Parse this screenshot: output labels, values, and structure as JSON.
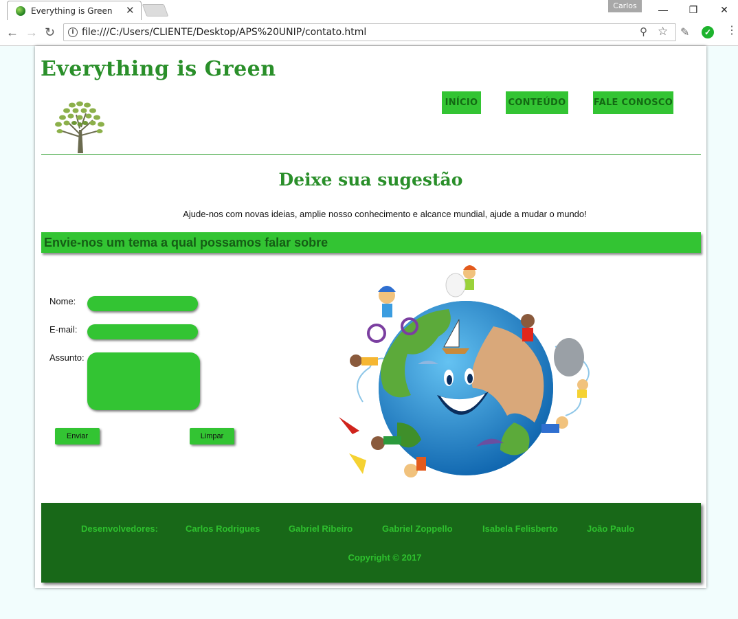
{
  "browser": {
    "tab_title": "Everything is Green",
    "tab_close": "✕",
    "profile": "Carlos",
    "url": "file:///C:/Users/CLIENTE/Desktop/APS%20UNIP/contato.html",
    "icons": [
      "favicon-icon",
      "close-icon",
      "back-icon",
      "forward-icon",
      "reload-icon",
      "info-icon",
      "zoom-icon",
      "star-icon",
      "eyedropper-icon",
      "check-icon",
      "menu-icon"
    ]
  },
  "site": {
    "title": "Everything is Green",
    "nav": [
      "INÍCIO",
      "CONTEÚDO",
      "FALE CONOSCO"
    ],
    "subtitle": "Deixe sua sugestão",
    "intro": "Ajude-nos com novas ideias, amplie nosso conhecimento e alcance mundial, ajude a mudar o mundo!",
    "banner": "Envie-nos um tema a qual possamos falar sobre"
  },
  "form": {
    "name_label": "Nome:",
    "email_label": "E-mail:",
    "subject_label": "Assunto:",
    "name_value": "",
    "email_value": "",
    "subject_value": "",
    "submit_label": "Enviar",
    "reset_label": "Limpar"
  },
  "footer": {
    "developers_label": "Desenvolvedores:",
    "developers": [
      "Carlos Rodrigues",
      "Gabriel Ribeiro",
      "Gabriel Zoppello",
      "Isabela Felisberto",
      "João Paulo"
    ],
    "copyright": "Copyright © 2017"
  },
  "colors": {
    "accent": "#33c433",
    "dark_green": "#186818",
    "title_green": "#2a8f2a",
    "footer_text": "#2ec02e"
  }
}
